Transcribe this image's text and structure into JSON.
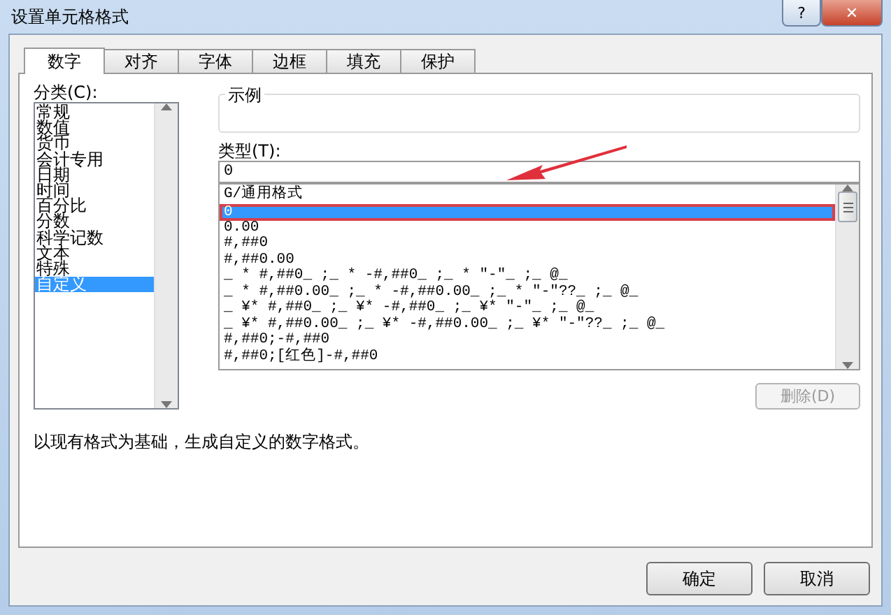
{
  "window": {
    "title": "设置单元格格式",
    "help": "?",
    "close": "✕"
  },
  "tabs": [
    {
      "label": "数字",
      "selected": true
    },
    {
      "label": "对齐",
      "selected": false
    },
    {
      "label": "字体",
      "selected": false
    },
    {
      "label": "边框",
      "selected": false
    },
    {
      "label": "填充",
      "selected": false
    },
    {
      "label": "保护",
      "selected": false
    }
  ],
  "category": {
    "label": "分类(C):",
    "items": [
      {
        "label": "常规",
        "selected": false
      },
      {
        "label": "数值",
        "selected": false
      },
      {
        "label": "货币",
        "selected": false
      },
      {
        "label": "会计专用",
        "selected": false
      },
      {
        "label": "日期",
        "selected": false
      },
      {
        "label": "时间",
        "selected": false
      },
      {
        "label": "百分比",
        "selected": false
      },
      {
        "label": "分数",
        "selected": false
      },
      {
        "label": "科学记数",
        "selected": false
      },
      {
        "label": "文本",
        "selected": false
      },
      {
        "label": "特殊",
        "selected": false
      },
      {
        "label": "自定义",
        "selected": true
      }
    ]
  },
  "sample": {
    "label": "示例"
  },
  "type": {
    "label": "类型(T):",
    "value": "0",
    "items": [
      {
        "label": "G/通用格式",
        "selected": false
      },
      {
        "label": "0",
        "selected": true
      },
      {
        "label": "0.00",
        "selected": false
      },
      {
        "label": "#,##0",
        "selected": false
      },
      {
        "label": "#,##0.00",
        "selected": false
      },
      {
        "label": "_ * #,##0_ ;_ * -#,##0_ ;_ * \"-\"_ ;_ @_",
        "selected": false
      },
      {
        "label": "_ * #,##0.00_ ;_ * -#,##0.00_ ;_ * \"-\"??_ ;_ @_",
        "selected": false
      },
      {
        "label": "_ ¥* #,##0_ ;_ ¥* -#,##0_ ;_ ¥* \"-\"_ ;_ @_",
        "selected": false
      },
      {
        "label": "_ ¥* #,##0.00_ ;_ ¥* -#,##0.00_ ;_ ¥* \"-\"??_ ;_ @_",
        "selected": false
      },
      {
        "label": "#,##0;-#,##0",
        "selected": false
      },
      {
        "label": "#,##0;[红色]-#,##0",
        "selected": false
      }
    ]
  },
  "delete_button": {
    "label": "删除(D)",
    "disabled": true
  },
  "description": "以现有格式为基础，生成自定义的数字格式。",
  "buttons": [
    "确定",
    "取消"
  ]
}
